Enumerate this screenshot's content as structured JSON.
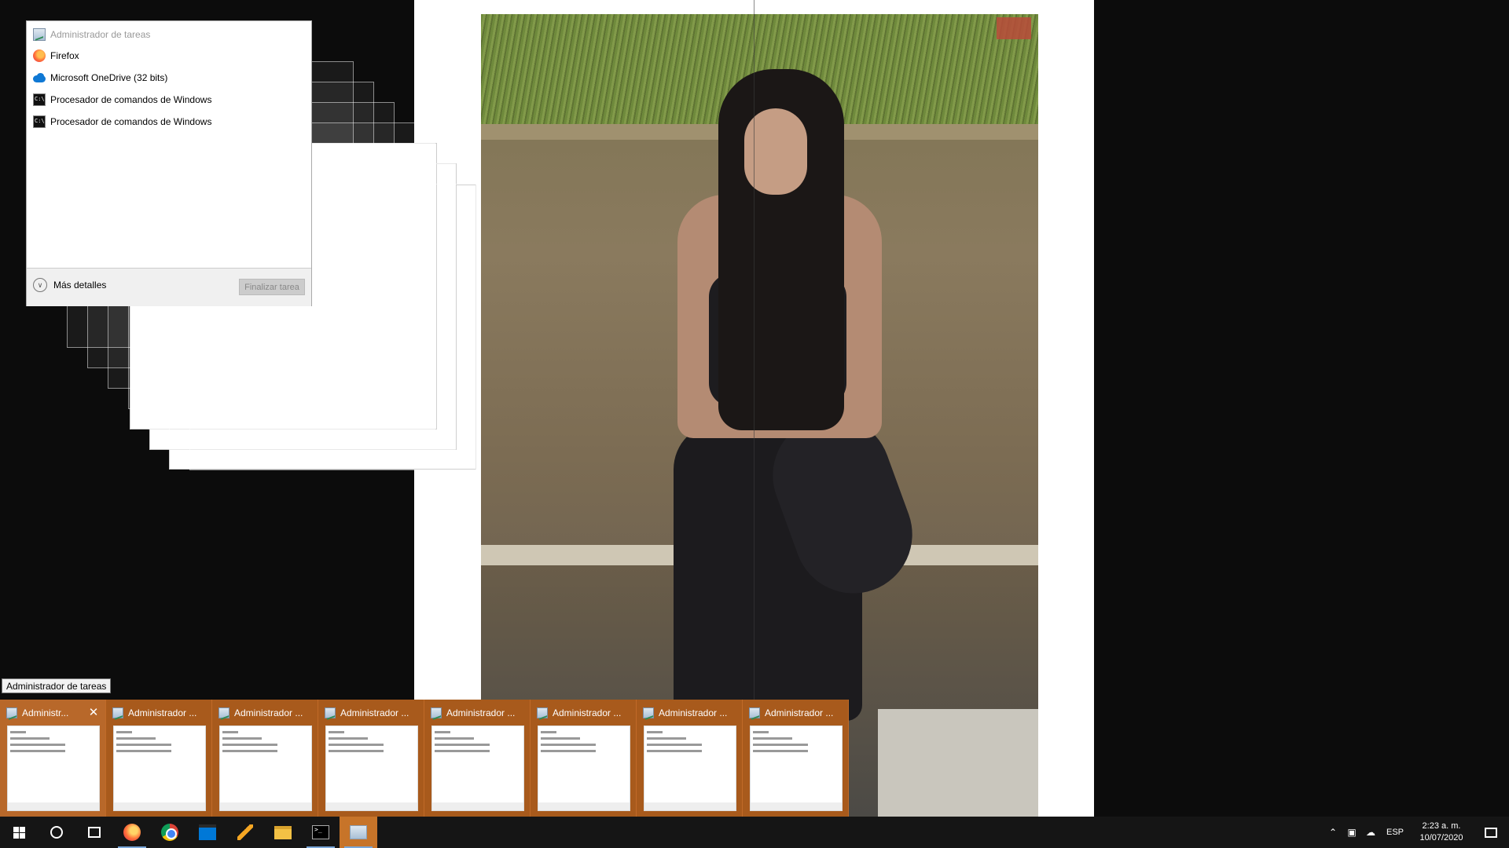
{
  "task_manager": {
    "title": "Administrador de tareas",
    "apps": [
      {
        "name": "Firefox",
        "icon": "firefox-icon"
      },
      {
        "name": "Microsoft OneDrive (32 bits)",
        "icon": "onedrive-icon"
      },
      {
        "name": "Procesador de comandos de Windows",
        "icon": "cmd-icon"
      },
      {
        "name": "Procesador de comandos de Windows",
        "icon": "cmd-icon"
      }
    ],
    "more_details": "Más detalles",
    "end_task": "Finalizar tarea"
  },
  "tooltip": "Administrador de tareas",
  "thumbnails": [
    {
      "title": "Administr..."
    },
    {
      "title": "Administrador ..."
    },
    {
      "title": "Administrador ..."
    },
    {
      "title": "Administrador ..."
    },
    {
      "title": "Administrador ..."
    },
    {
      "title": "Administrador ..."
    },
    {
      "title": "Administrador ..."
    },
    {
      "title": "Administrador ..."
    }
  ],
  "taskbar": {
    "apps": [
      "start-icon",
      "cortana-icon",
      "task-view-icon",
      "firefox-icon",
      "chrome-icon",
      "store-icon",
      "bolt-app-icon",
      "file-explorer-icon",
      "cmd-icon",
      "task-manager-icon"
    ],
    "language": "ESP",
    "time": "2:23 a. m.",
    "date": "10/07/2020",
    "accent": "#c77429"
  }
}
